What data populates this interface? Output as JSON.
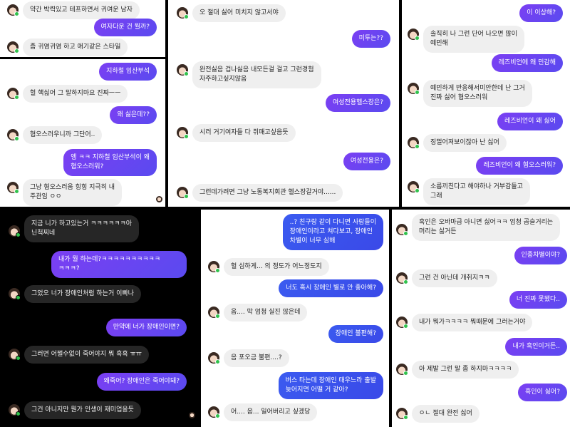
{
  "panel1": {
    "messages": [
      {
        "side": "in",
        "text": "약간 박력있고 테프하면서 귀여운 남자"
      },
      {
        "side": "out",
        "text": "여자다운 건 뭘까?"
      },
      {
        "side": "in",
        "text": "좀 귀염귀염 하고 애기같은 스타일"
      }
    ]
  },
  "panel2": {
    "messages": [
      {
        "side": "out",
        "text": "지하철 임산부석"
      },
      {
        "side": "in",
        "text": "헐 핵싫어 그 말하지마요 진짜ㅡㅡ"
      },
      {
        "side": "out",
        "text": "왜 싫은데??"
      },
      {
        "side": "in",
        "text": "혐오스러우니까 그단어.."
      },
      {
        "side": "out",
        "text": "엥 ㅋㅋ 지하철 임산부석이 왜\n혐오스러워?"
      },
      {
        "side": "in",
        "text": "그냥 혐오스러움 힝힝 지극히 내\n주관임 ㅇㅇ"
      }
    ]
  },
  "panel3": {
    "messages": [
      {
        "side": "in",
        "text": "오 절대 싫어 미치지 않고서야"
      },
      {
        "side": "out",
        "text": "미투는??"
      },
      {
        "side": "in",
        "text": "완전싫음 겁나싫음 내모든걸 걸고 그런경험\n자주하고싶지않음"
      },
      {
        "side": "out",
        "text": "여성전용헬스장은?"
      },
      {
        "side": "in",
        "text": "시러 거기여자들 다 쥐패고싶음듯"
      },
      {
        "side": "out",
        "text": "여성전용은?"
      },
      {
        "side": "in",
        "text": "그런데가려면 그냥 노동복지회관 헬스장갈거야......"
      }
    ]
  },
  "panel4": {
    "messages": [
      {
        "side": "out",
        "text": "이 이상해?"
      },
      {
        "side": "in",
        "text": "솔직히 나 그런 단어 나오면 많이\n예민해"
      },
      {
        "side": "out",
        "text": "레즈비언에 왜 민감해"
      },
      {
        "side": "in",
        "text": "예민하게 반응해서미안한데 난 그거\n진짜 싫어 혐오스러워"
      },
      {
        "side": "out",
        "text": "레즈비언이 왜 싫어"
      },
      {
        "side": "in",
        "text": "징멀어져보이잖아 난 싫어"
      },
      {
        "side": "out",
        "text": "레즈비언이 왜 혐오스러워?"
      },
      {
        "side": "in",
        "text": "소름끼친다고 해야하나 거부감들고\n그래"
      }
    ]
  },
  "panel5": {
    "messages": [
      {
        "side": "in",
        "text": "지금 니가 하고있는거 ㅋㅋㅋㅋㅋㅋ아\n닌척찌네"
      },
      {
        "side": "out",
        "text": "내가 뭘 하는데?ㅋㅋㅋㅋㅋㅋㅋㅋㅋㅋ\nㅋㅋㅋ?"
      },
      {
        "side": "in",
        "text": "그었오 너가 장애인처럼 하는거 이빠나"
      }
    ]
  },
  "panel6": {
    "messages": [
      {
        "side": "out",
        "text": "만약에 너가 장애인이면?"
      },
      {
        "side": "in",
        "text": "그러면 어쩔수없이 죽어야지 뭐 흑흑 ㅠㅠ"
      },
      {
        "side": "out",
        "text": "왜죽어? 장애인은 죽어야돼?"
      },
      {
        "side": "in",
        "text": "그건 아니지만 뭔가 인생이 재미업을듯"
      }
    ]
  },
  "panel7": {
    "messages": [
      {
        "side": "out",
        "text": "..? 친구랑 같이 다니면 사람들이\n장애인이라고 쳐다보고, 장애인\n차별이 너무 심해"
      },
      {
        "side": "in",
        "text": "헐 심하게... 의 정도가 어느정도지"
      },
      {
        "side": "out",
        "text": "너도 혹시 장애인 별로 안 좋아해?"
      },
      {
        "side": "in",
        "text": "음.... 막 엄청 실진 않은데"
      },
      {
        "side": "out",
        "text": "장애인 불편해?"
      },
      {
        "side": "in",
        "text": "음 포오금 불편....?"
      },
      {
        "side": "out",
        "text": "버스 타는데 장애인 태우느라 출발\n늦어지면 어떨 거 같아?"
      },
      {
        "side": "in",
        "text": "어.... 음... 일어버리고 싶겠당"
      }
    ]
  },
  "panel8": {
    "messages": [
      {
        "side": "in",
        "text": "흑인은 오바마급 아니면 싫어ㅋㅋ 엄청 곱슬거리는\n머리는 싫거든"
      },
      {
        "side": "out",
        "text": "인종차별이야?"
      },
      {
        "side": "in",
        "text": "그런 건 아닌데 개취지ㅋㅋ"
      },
      {
        "side": "out",
        "text": "너 진짜 못됐다.."
      },
      {
        "side": "in",
        "text": "내가 뭐가ㅋㅋㅋㅋ 뭐때문에 그러는거야"
      },
      {
        "side": "out",
        "text": "내가 흑인이거든.."
      },
      {
        "side": "in",
        "text": "아 제발 그런 말 좀 하지마ㅋㅋㅋㅋ"
      },
      {
        "side": "out",
        "text": "흑인이 싫어?"
      },
      {
        "side": "in",
        "text": "ㅇㄴ 절대 완전 싫어"
      }
    ]
  }
}
